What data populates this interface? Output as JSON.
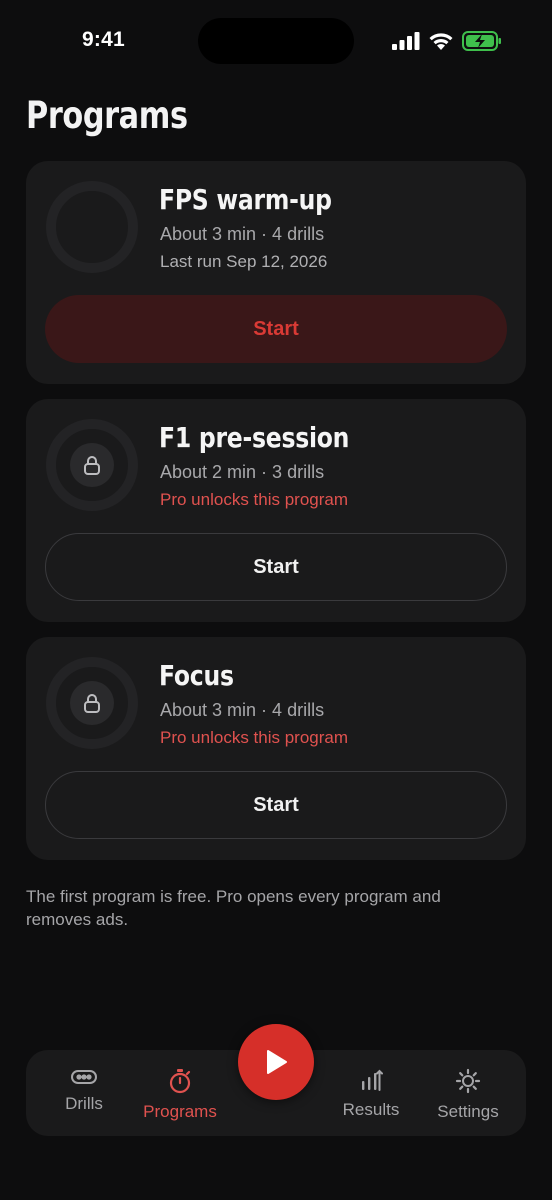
{
  "status_bar": {
    "time": "9:41"
  },
  "page": {
    "title": "Programs"
  },
  "programs": [
    {
      "title": "FPS warm-up",
      "meta": "About 3 min · 4 drills",
      "note": "Last run Sep 12, 2026",
      "button": "Start",
      "locked": false
    },
    {
      "title": "F1 pre-session",
      "meta": "About 2 min · 3 drills",
      "note": "Pro unlocks this program",
      "button": "Start",
      "locked": true
    },
    {
      "title": "Focus",
      "meta": "About 3 min · 4 drills",
      "note": "Pro unlocks this program",
      "button": "Start",
      "locked": true
    }
  ],
  "footnote": "The first program is free. Pro opens every program and removes ads.",
  "tabbar": {
    "tabs": [
      {
        "label": "Drills",
        "icon": "drills-icon"
      },
      {
        "label": "Programs",
        "icon": "stopwatch-icon",
        "active": true
      },
      {
        "label": "Results",
        "icon": "bars-icon"
      },
      {
        "label": "Settings",
        "icon": "gear-icon"
      }
    ],
    "center_action": "play-icon"
  },
  "colors": {
    "accent": "#d62f29",
    "accent_text": "#e0524f",
    "background": "#0d0d0e",
    "card": "#1a1a1b",
    "primary_button_bg": "#3a1718"
  }
}
